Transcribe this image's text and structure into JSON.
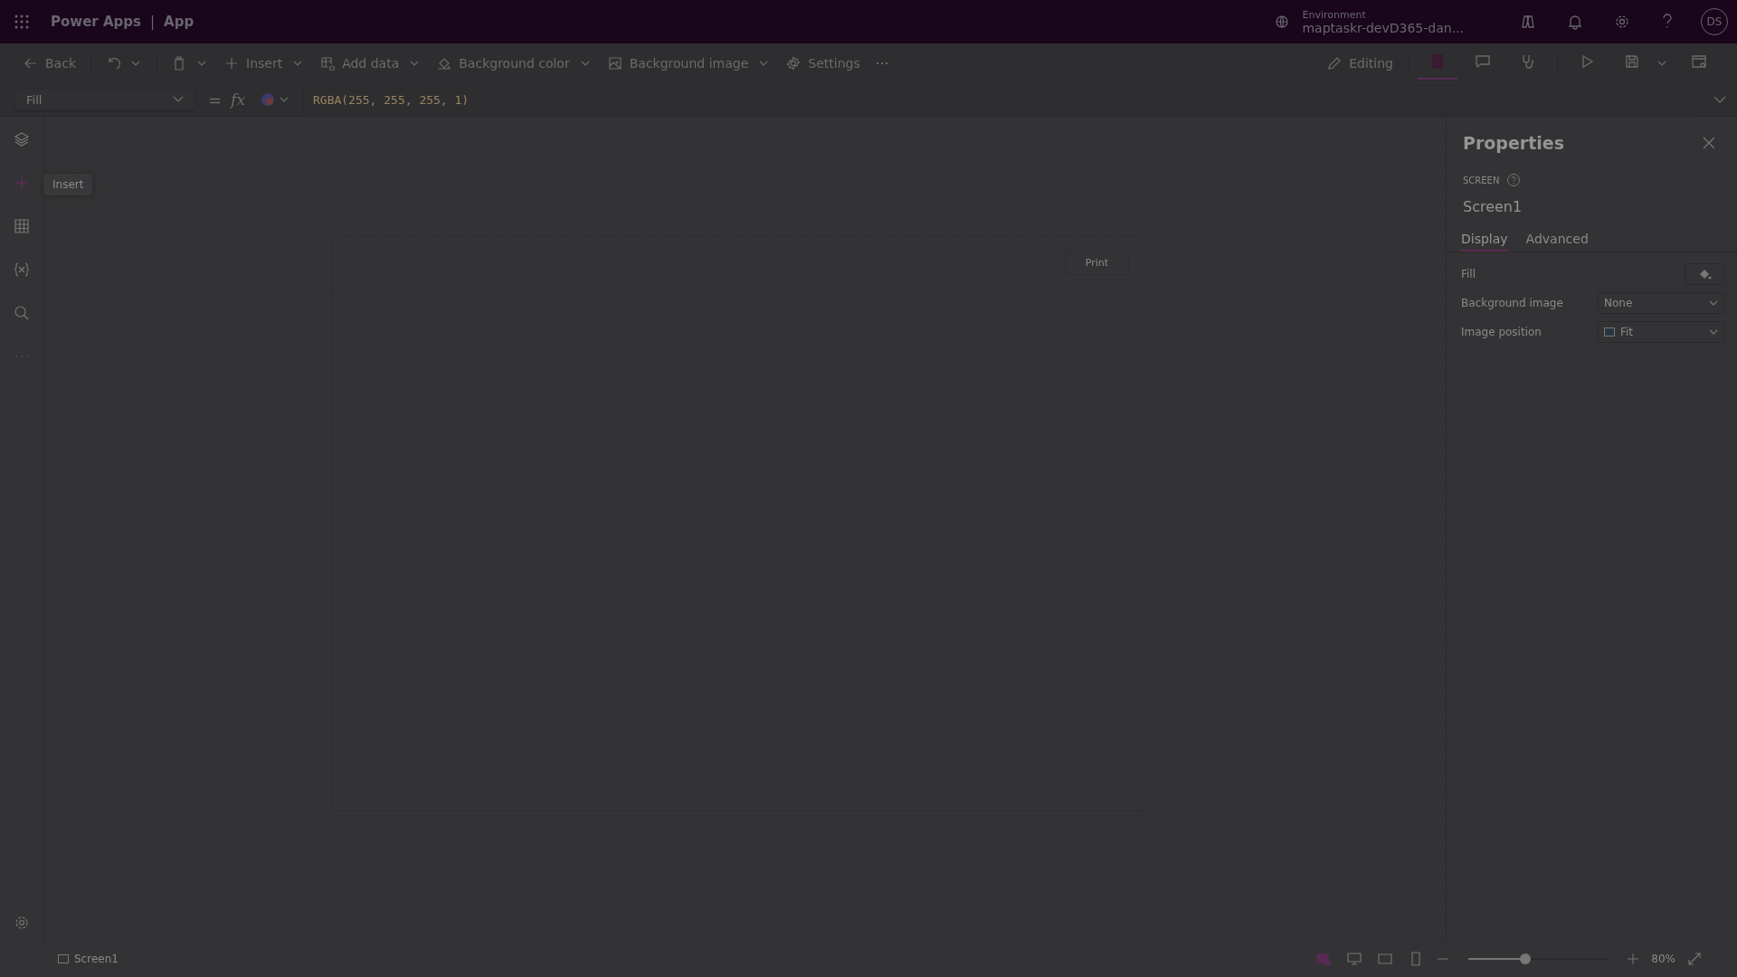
{
  "header": {
    "product": "Power Apps",
    "separator": "|",
    "app_name": "App",
    "environment_label": "Environment",
    "environment_value": "maptaskr-devD365-dan...",
    "avatar": "DS"
  },
  "toolbar": {
    "left": [
      {
        "kind": "back",
        "label": "Back"
      },
      {
        "kind": "undo"
      },
      {
        "kind": "paste"
      },
      {
        "kind": "insert",
        "label": "Insert"
      },
      {
        "kind": "data",
        "label": "Add data"
      },
      {
        "kind": "color",
        "label": "Background color"
      },
      {
        "kind": "image",
        "label": "Background image"
      },
      {
        "kind": "settings",
        "label": "Settings"
      },
      {
        "kind": "more"
      }
    ],
    "editing": "Editing",
    "right": [
      {
        "kind": "notes",
        "selected": true
      },
      {
        "kind": "comment",
        "selected": false
      },
      {
        "kind": "checker",
        "selected": false
      },
      {
        "kind": "play",
        "selected": false
      },
      {
        "kind": "save",
        "selected": false
      },
      {
        "kind": "publish",
        "selected": false
      }
    ]
  },
  "formula_bar": {
    "property": "Fill",
    "equals": "=",
    "fx": "fx",
    "value": "RGBA(255, 255, 255, 1)"
  },
  "rail": [
    {
      "kind": "layers",
      "selected": false
    },
    {
      "kind": "insert",
      "selected": true
    },
    {
      "kind": "data",
      "selected": false
    },
    {
      "kind": "variables",
      "selected": false
    },
    {
      "kind": "search",
      "selected": false
    },
    {
      "kind": "more",
      "selected": false
    }
  ],
  "tooltip": "Insert",
  "canvas": {
    "button": "Print"
  },
  "properties": {
    "title": "Properties",
    "type": "SCREEN",
    "name": "Screen1",
    "tabs": [
      {
        "label": "Display",
        "selected": true
      },
      {
        "label": "Advanced",
        "selected": false
      }
    ],
    "rows": [
      {
        "kind": "color",
        "label": "Fill"
      },
      {
        "kind": "dropdown",
        "label": "Background image",
        "value": "None"
      },
      {
        "kind": "dropdown",
        "label": "Image position",
        "value": "Fit",
        "icon": true
      }
    ]
  },
  "status_bar": {
    "screen": "Screen1",
    "devices": [
      {
        "kind": "fit",
        "selected": true
      },
      {
        "kind": "desktop",
        "selected": false
      },
      {
        "kind": "tablet",
        "selected": false
      },
      {
        "kind": "phone",
        "selected": false
      }
    ],
    "zoom": {
      "level": 0.4
    },
    "zoom_text": "80%"
  }
}
